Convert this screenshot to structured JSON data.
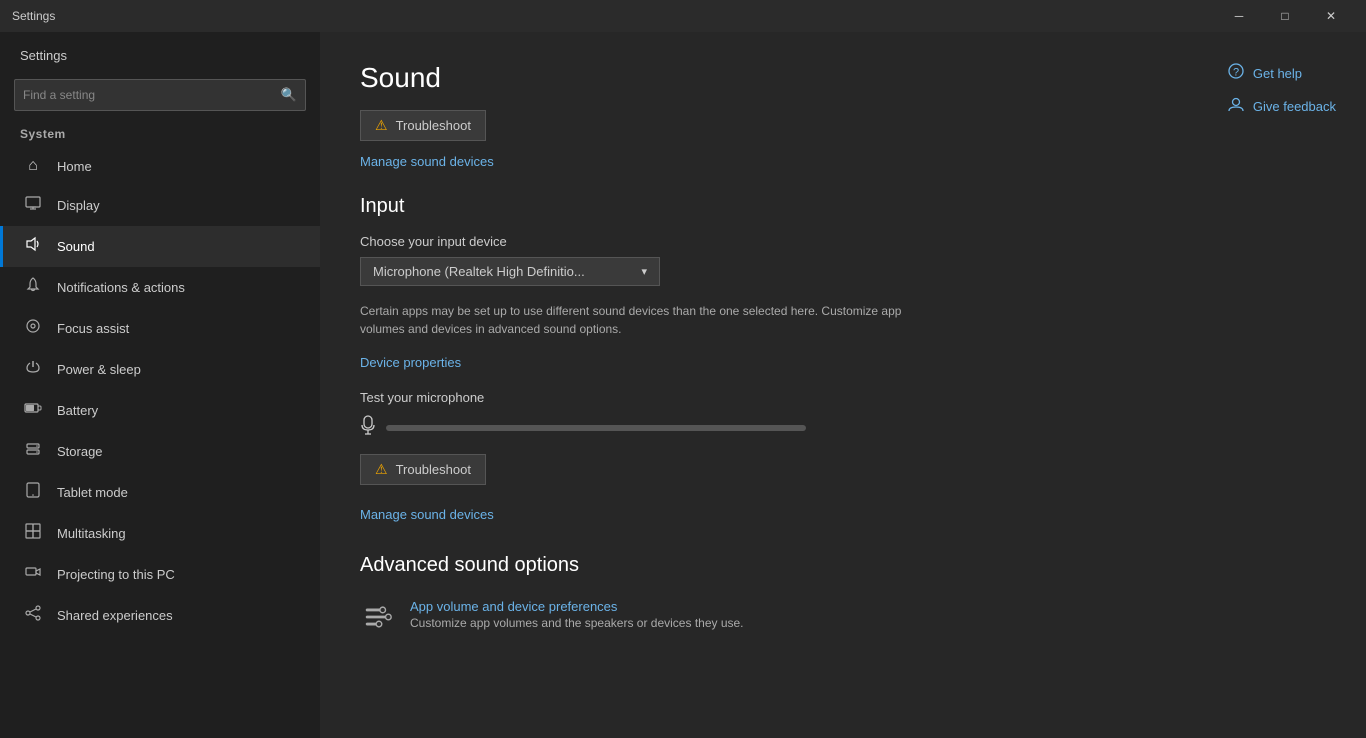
{
  "titlebar": {
    "title": "Settings",
    "minimize": "─",
    "maximize": "□",
    "close": "✕"
  },
  "sidebar": {
    "header": "Settings",
    "search_placeholder": "Find a setting",
    "system_label": "System",
    "nav_items": [
      {
        "id": "home",
        "label": "Home",
        "icon": "⌂",
        "active": false
      },
      {
        "id": "display",
        "label": "Display",
        "icon": "▭",
        "active": false
      },
      {
        "id": "sound",
        "label": "Sound",
        "icon": "🔊",
        "active": true
      },
      {
        "id": "notifications",
        "label": "Notifications & actions",
        "icon": "🔔",
        "active": false
      },
      {
        "id": "focus",
        "label": "Focus assist",
        "icon": "◯",
        "active": false
      },
      {
        "id": "power",
        "label": "Power & sleep",
        "icon": "⏻",
        "active": false
      },
      {
        "id": "battery",
        "label": "Battery",
        "icon": "🔋",
        "active": false
      },
      {
        "id": "storage",
        "label": "Storage",
        "icon": "💾",
        "active": false
      },
      {
        "id": "tablet",
        "label": "Tablet mode",
        "icon": "📱",
        "active": false
      },
      {
        "id": "multitasking",
        "label": "Multitasking",
        "icon": "⧉",
        "active": false
      },
      {
        "id": "projecting",
        "label": "Projecting to this PC",
        "icon": "📽",
        "active": false
      },
      {
        "id": "shared",
        "label": "Shared experiences",
        "icon": "⤢",
        "active": false
      }
    ]
  },
  "content": {
    "page_title": "Sound",
    "troubleshoot_top_label": "Troubleshoot",
    "manage_devices_top": "Manage sound devices",
    "input_section_title": "Input",
    "input_device_label": "Choose your input device",
    "input_device_value": "Microphone (Realtek High Definitio...",
    "input_description": "Certain apps may be set up to use different sound devices than the one selected here. Customize app volumes and devices in advanced sound options.",
    "device_properties_link": "Device properties",
    "test_mic_label": "Test your microphone",
    "troubleshoot_bottom_label": "Troubleshoot",
    "manage_devices_bottom": "Manage sound devices",
    "advanced_title": "Advanced sound options",
    "app_vol_title": "App volume and device preferences",
    "app_vol_desc": "Customize app volumes and the speakers or devices they use.",
    "help_items": [
      {
        "id": "get-help",
        "label": "Get help",
        "icon": "💬"
      },
      {
        "id": "give-feedback",
        "label": "Give feedback",
        "icon": "👤"
      }
    ]
  }
}
